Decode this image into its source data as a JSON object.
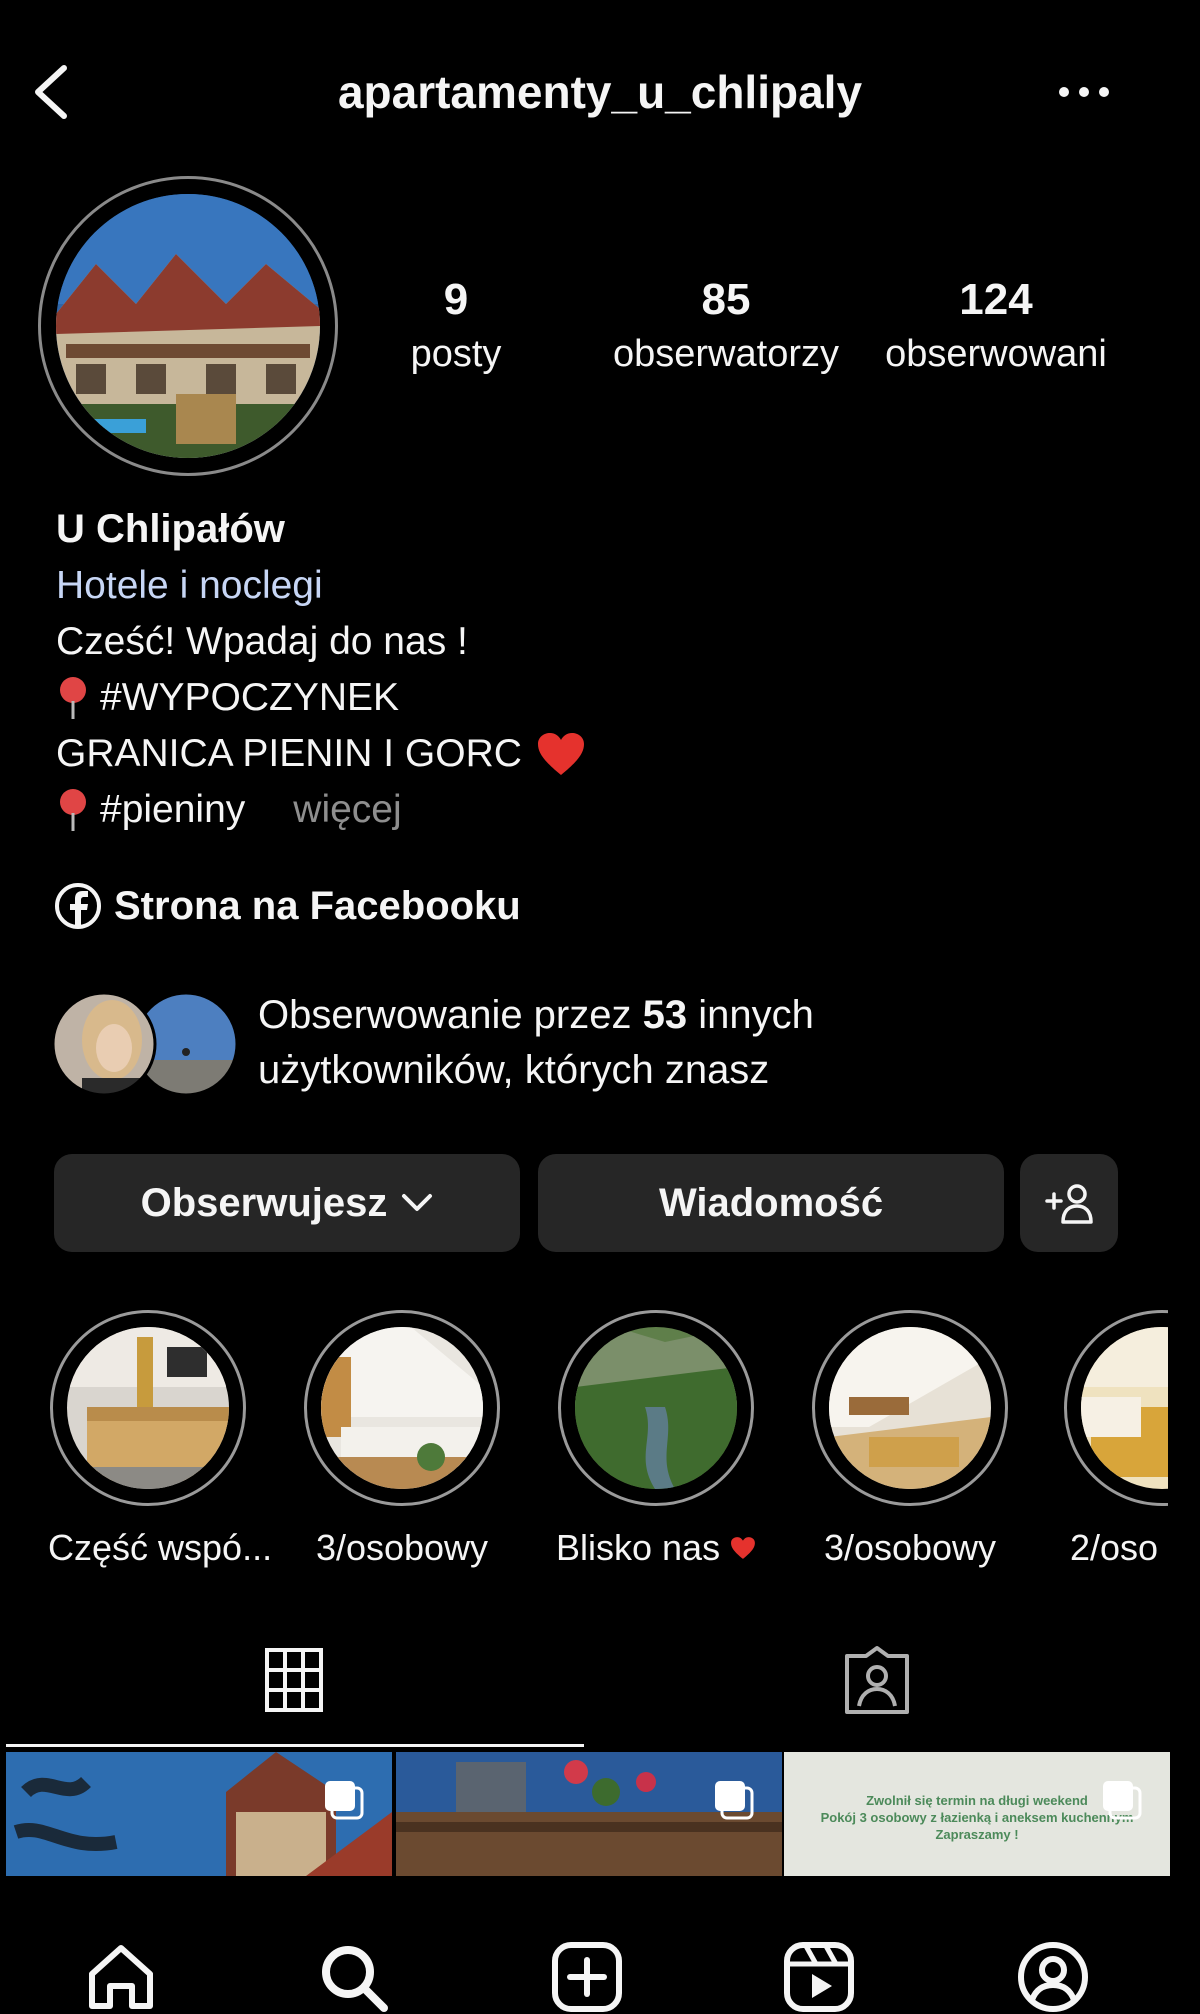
{
  "header": {
    "username": "apartamenty_u_chlipaly",
    "back_icon": "chevron-left-icon",
    "more_icon": "more-horizontal-icon"
  },
  "profile": {
    "stats": [
      {
        "value": "9",
        "label": "posty"
      },
      {
        "value": "85",
        "label": "obserwatorzy"
      },
      {
        "value": "124",
        "label": "obserwowani"
      }
    ],
    "name": "U Chlipałów",
    "category": "Hotele i noclegi",
    "bio_line1": "Cześć! Wpadaj do nas !",
    "bio_line2": "#WYPOCZYNEK",
    "bio_line3": "GRANICA PIENIN I GORC",
    "bio_line4": "#pieniny",
    "more_label": "więcej",
    "facebook_link": "Strona na Facebooku",
    "mutual_prefix": "Obserwowanie przez ",
    "mutual_count": "53",
    "mutual_suffix": " innych",
    "mutual_line2": "użytkowników, których znasz"
  },
  "actions": {
    "following_label": "Obserwujesz",
    "message_label": "Wiadomość"
  },
  "highlights": [
    {
      "label": "Część wspó..."
    },
    {
      "label": "3/osobowy"
    },
    {
      "label": "Blisko nas"
    },
    {
      "label": "3/osobowy"
    },
    {
      "label": "2/oso"
    }
  ],
  "post3_text": {
    "line1": "Zwolnił się termin na długi weekend",
    "line2": "Pokój 3 osobowy z łazienką i aneksem kuchennym",
    "line3": "Zapraszamy !"
  },
  "colors": {
    "background": "#000000",
    "button": "#262626",
    "category_link": "#c7d6f5",
    "muted": "#8e8e8e",
    "heart": "#e5322d",
    "pin": "#e04545"
  }
}
